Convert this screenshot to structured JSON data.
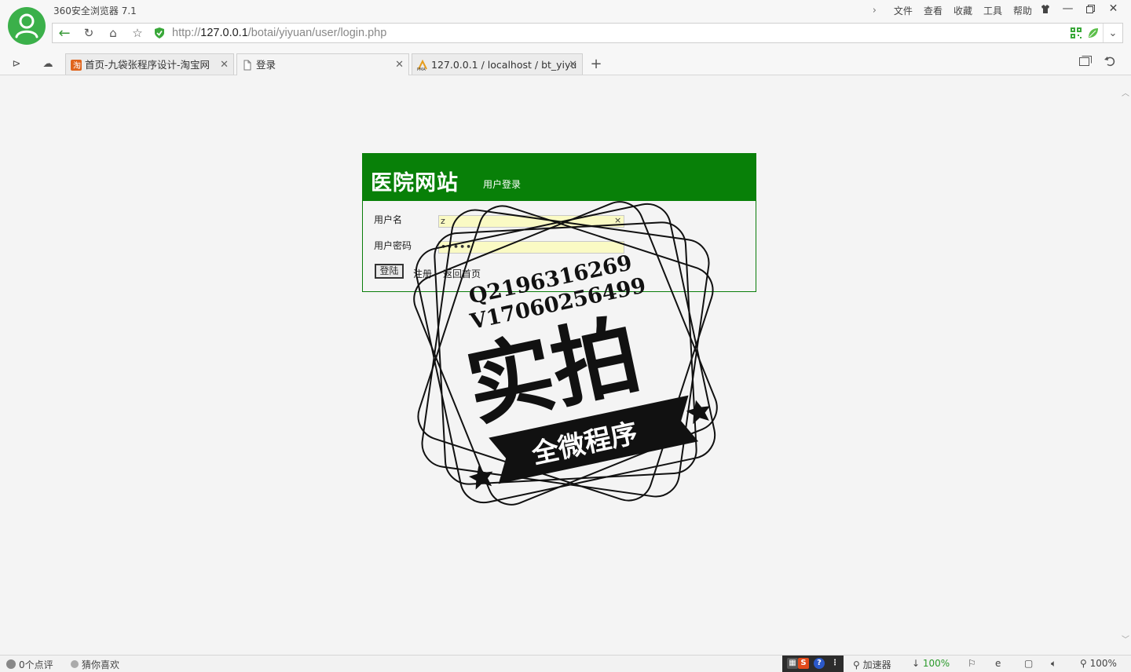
{
  "app": {
    "title": "360安全浏览器 7.1"
  },
  "menu": [
    "文件",
    "查看",
    "收藏",
    "工具",
    "帮助"
  ],
  "window_controls": [
    "shirt-icon",
    "minimize-icon",
    "restore-icon",
    "close-icon"
  ],
  "address": {
    "prefix": "http://",
    "host": "127.0.0.1",
    "path": "/botai/yiyuan/user/login.php"
  },
  "tabs": [
    {
      "label": "首页-九袋张程序设计-淘宝网",
      "icon": "taobao-icon"
    },
    {
      "label": "登录",
      "icon": "page-icon",
      "active": true
    },
    {
      "label": "127.0.0.1 / localhost / bt_yiyu",
      "icon": "pma-icon"
    }
  ],
  "login": {
    "site_title": "医院网站",
    "subtitle": "用户登录",
    "username_label": "用户名",
    "username_value": "z",
    "password_label": "用户密码",
    "password_value": "•••••",
    "clear_glyph": "×",
    "submit_label": "登陆",
    "register_label": "注册",
    "home_label": "返回首页"
  },
  "watermark": {
    "line1": "Q2196316269",
    "line2": "V17060256499",
    "main": "实拍",
    "banner": "全微程序"
  },
  "status": {
    "reviews": "0个点评",
    "guess": "猜你喜欢",
    "accelerator": "加速器",
    "download": "100%",
    "zoom": "100%"
  },
  "colors": {
    "brand_green": "#088008",
    "avatar_green": "#3bb04a",
    "input_bg": "#fafac4"
  }
}
